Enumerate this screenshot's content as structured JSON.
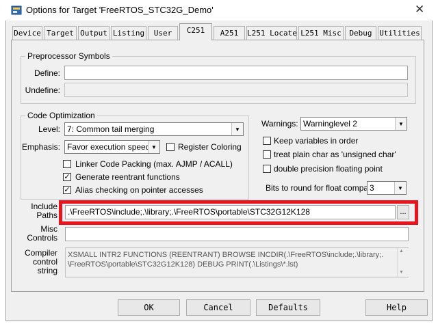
{
  "window": {
    "title": "Options for Target 'FreeRTOS_STC32G_Demo'",
    "close_glyph": "✕",
    "app_icon": "keil-uvision-icon"
  },
  "tabs": [
    {
      "label": "Device"
    },
    {
      "label": "Target"
    },
    {
      "label": "Output"
    },
    {
      "label": "Listing"
    },
    {
      "label": "User"
    },
    {
      "label": "C251"
    },
    {
      "label": "A251"
    },
    {
      "label": "L251 Locate"
    },
    {
      "label": "L251 Misc"
    },
    {
      "label": "Debug"
    },
    {
      "label": "Utilities"
    }
  ],
  "preprocessor": {
    "group_label": "Preprocessor Symbols",
    "define_label": "Define:",
    "define_value": "",
    "undefine_label": "Undefine:",
    "undefine_value": ""
  },
  "code_opt": {
    "group_label": "Code Optimization",
    "level_label": "Level:",
    "level_value": "7: Common tail merging",
    "emphasis_label": "Emphasis:",
    "emphasis_value": "Favor execution speed",
    "register_coloring": {
      "label": "Register Coloring",
      "checked": false
    },
    "linker_packing": {
      "label": "Linker Code Packing (max. AJMP / ACALL)",
      "checked": false
    },
    "reentrant": {
      "label": "Generate reentrant functions",
      "checked": true
    },
    "alias": {
      "label": "Alias checking on pointer accesses",
      "checked": true
    }
  },
  "right_opts": {
    "warnings_label": "Warnings:",
    "warnings_value": "Warninglevel 2",
    "keep_vars": {
      "label": "Keep variables in order",
      "checked": false
    },
    "plain_char": {
      "label": "treat plain char as 'unsigned char'",
      "checked": false
    },
    "double_prec": {
      "label": "double precision floating point",
      "checked": false
    },
    "bits_label": "Bits to round for float compare:",
    "bits_value": "3"
  },
  "include": {
    "label_line1": "Include",
    "label_line2": "Paths",
    "value": ".\\FreeRTOS\\include;.\\library;.\\FreeRTOS\\portable\\STC32G12K128",
    "browse_label": "..."
  },
  "misc": {
    "label_line1": "Misc",
    "label_line2": "Controls",
    "value": ""
  },
  "compiler": {
    "label_line1": "Compiler",
    "label_line2": "control",
    "label_line3": "string",
    "line1": "XSMALL INTR2 FUNCTIONS (REENTRANT) BROWSE INCDIR(.\\FreeRTOS\\include;.\\library;.",
    "line2": "\\FreeRTOS\\portable\\STC32G12K128) DEBUG PRINT(.\\Listings\\*.lst)"
  },
  "buttons": {
    "ok": "OK",
    "cancel": "Cancel",
    "defaults": "Defaults",
    "help": "Help"
  },
  "colors": {
    "highlight": "#e8151f",
    "dialog_bg": "#f0f0f0"
  }
}
